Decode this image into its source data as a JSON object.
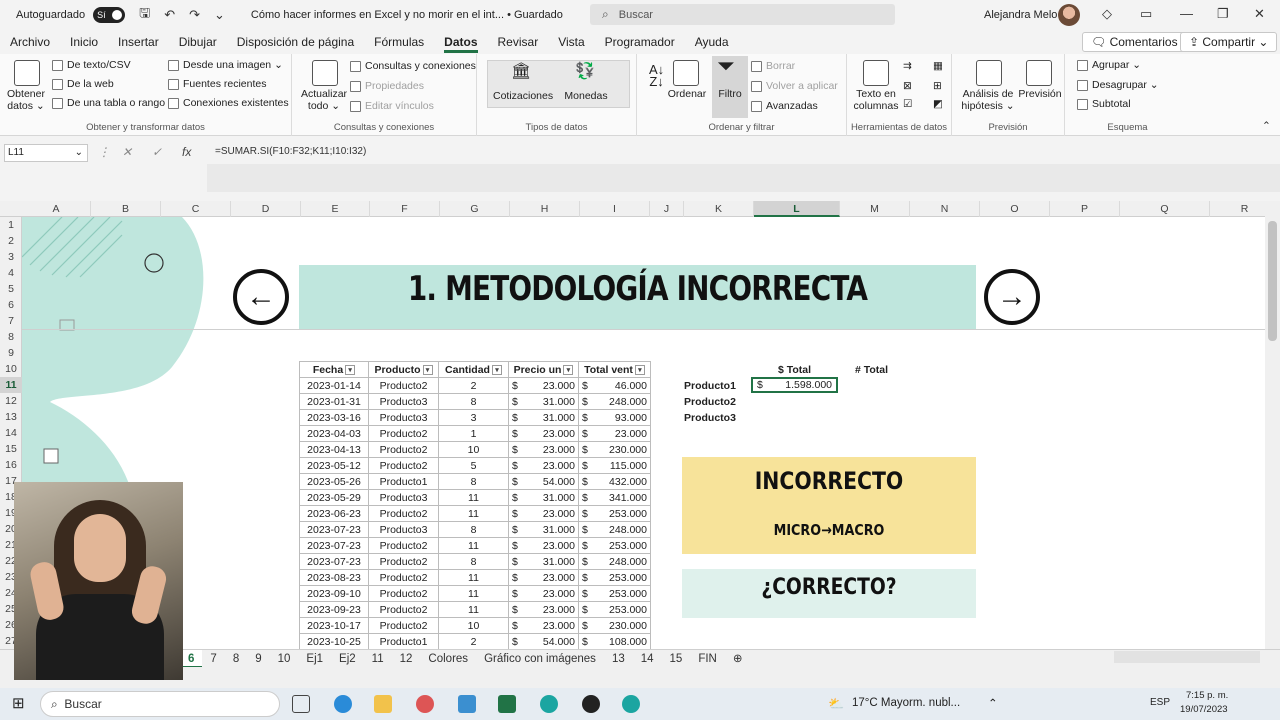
{
  "titlebar": {
    "autosave_label": "Autoguardado",
    "autosave_state": "Sí",
    "doc_title": "Cómo hacer informes en Excel y no morir en el int... • Guardado",
    "search_placeholder": "Buscar",
    "user_name": "Alejandra Melo"
  },
  "tabs": [
    "Archivo",
    "Inicio",
    "Insertar",
    "Dibujar",
    "Disposición de página",
    "Fórmulas",
    "Datos",
    "Revisar",
    "Vista",
    "Programador",
    "Ayuda"
  ],
  "active_tab": "Datos",
  "comments_label": "Comentarios",
  "share_label": "Compartir",
  "ribbon": {
    "obtener": {
      "big": "Obtener\ndatos",
      "items": [
        "De texto/CSV",
        "De la web",
        "De una tabla o rango",
        "Desde una imagen",
        "Fuentes recientes",
        "Conexiones existentes"
      ],
      "label": "Obtener y transformar datos"
    },
    "consultas": {
      "big": "Actualizar\ntodo",
      "items": [
        "Consultas y conexiones",
        "Propiedades",
        "Editar vínculos"
      ],
      "label": "Consultas y conexiones"
    },
    "tipos": {
      "items": [
        "Cotizaciones",
        "Monedas"
      ],
      "label": "Tipos de datos"
    },
    "ordenar": {
      "items": [
        "Ordenar",
        "Filtro",
        "Borrar",
        "Volver a aplicar",
        "Avanzadas"
      ],
      "label": "Ordenar y filtrar"
    },
    "herramientas": {
      "big": "Texto en\ncolumnas",
      "label": "Herramientas de datos"
    },
    "prevision": {
      "items": [
        "Análisis de\nhipótesis",
        "Previsión"
      ],
      "label": "Previsión"
    },
    "esquema": {
      "items": [
        "Agrupar",
        "Desagrupar",
        "Subtotal"
      ],
      "label": "Esquema"
    }
  },
  "formula_bar": {
    "name_box": "L11",
    "formula": "=SUMAR.SI(F10:F32;K11;I10:I32)"
  },
  "columns": [
    "A",
    "B",
    "C",
    "D",
    "E",
    "F",
    "G",
    "H",
    "I",
    "J",
    "K",
    "L",
    "M",
    "N",
    "O",
    "P",
    "Q",
    "R"
  ],
  "selected_column": "L",
  "rows": [
    "1",
    "2",
    "3",
    "4",
    "5",
    "6",
    "7",
    "8",
    "9",
    "10",
    "11",
    "12",
    "13",
    "14",
    "15",
    "16",
    "17",
    "18",
    "19",
    "20",
    "21",
    "22",
    "23",
    "24",
    "25",
    "26",
    "27"
  ],
  "selected_row": "11",
  "banner_title": "1. METODOLOGÍA INCORRECTA",
  "table": {
    "headers": [
      "Fecha",
      "Producto",
      "Cantidad",
      "Precio un",
      "Total vent"
    ],
    "currency": "$",
    "rows": [
      [
        "2023-01-14",
        "Producto2",
        "2",
        "23.000",
        "46.000"
      ],
      [
        "2023-01-31",
        "Producto3",
        "8",
        "31.000",
        "248.000"
      ],
      [
        "2023-03-16",
        "Producto3",
        "3",
        "31.000",
        "93.000"
      ],
      [
        "2023-04-03",
        "Producto2",
        "1",
        "23.000",
        "23.000"
      ],
      [
        "2023-04-13",
        "Producto2",
        "10",
        "23.000",
        "230.000"
      ],
      [
        "2023-05-12",
        "Producto2",
        "5",
        "23.000",
        "115.000"
      ],
      [
        "2023-05-26",
        "Producto1",
        "8",
        "54.000",
        "432.000"
      ],
      [
        "2023-05-29",
        "Producto3",
        "11",
        "31.000",
        "341.000"
      ],
      [
        "2023-06-23",
        "Producto2",
        "11",
        "23.000",
        "253.000"
      ],
      [
        "2023-07-23",
        "Producto3",
        "8",
        "31.000",
        "248.000"
      ],
      [
        "2023-07-23",
        "Producto2",
        "11",
        "23.000",
        "253.000"
      ],
      [
        "2023-07-23",
        "Producto2",
        "8",
        "31.000",
        "248.000"
      ],
      [
        "2023-08-23",
        "Producto2",
        "11",
        "23.000",
        "253.000"
      ],
      [
        "2023-09-10",
        "Producto2",
        "11",
        "23.000",
        "253.000"
      ],
      [
        "2023-09-23",
        "Producto2",
        "11",
        "23.000",
        "253.000"
      ],
      [
        "2023-10-17",
        "Producto2",
        "10",
        "23.000",
        "230.000"
      ],
      [
        "2023-10-25",
        "Producto1",
        "2",
        "54.000",
        "108.000"
      ]
    ]
  },
  "summary": {
    "header_total": "$ Total",
    "header_count": "# Total",
    "products": [
      "Producto1",
      "Producto2",
      "Producto3"
    ],
    "p1_currency": "$",
    "p1_total": "1.598.000"
  },
  "cards": {
    "incorrect_title": "INCORRECTO",
    "incorrect_sub_left": "MICRO",
    "incorrect_arrow": "→",
    "incorrect_sub_right": "MACRO",
    "incorrect_color": "#f7e39a",
    "correct_title": "¿CORRECTO?",
    "correct_color": "#dff1ec"
  },
  "banner_color": "#bfe6dd",
  "sheet_tabs": [
    "6",
    "7",
    "8",
    "9",
    "10",
    "Ej1",
    "Ej2",
    "11",
    "12",
    "Colores",
    "Gráfico con imágenes",
    "13",
    "14",
    "15",
    "FIN"
  ],
  "active_sheet": "6",
  "taskbar": {
    "search": "Buscar",
    "weather": "17°C  Mayorm. nubl...",
    "lang": "ESP",
    "time": "7:15 p. m.",
    "date": "19/07/2023"
  }
}
